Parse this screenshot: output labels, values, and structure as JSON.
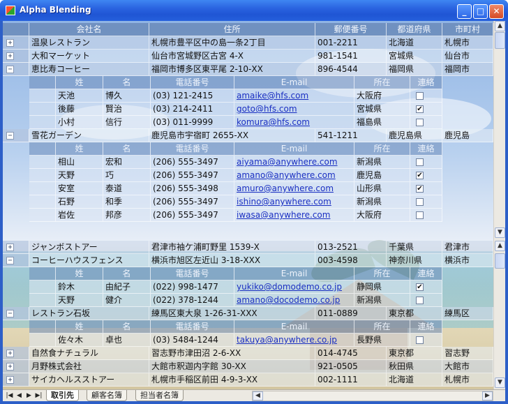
{
  "window": {
    "title": "Alpha Blending",
    "minimize_glyph": "_",
    "maximize_glyph": "□",
    "close_glyph": "✕"
  },
  "columns": [
    "会社名",
    "住所",
    "郵便番号",
    "都道府県",
    "市町村"
  ],
  "detail_columns": [
    "姓",
    "名",
    "電話番号",
    "E-mail",
    "所在",
    "連絡"
  ],
  "groups_top": [
    {
      "company": "温泉レストラン",
      "address": "札幌市豊平区中の島一条2丁目",
      "postal": "001-2211",
      "prefecture": "北海道",
      "city": "札幌市",
      "expander": "+",
      "contacts": []
    },
    {
      "company": "大和マーケット",
      "address": "仙台市宮城野区古宮 4-X",
      "postal": "981-1541",
      "prefecture": "宮城県",
      "city": "仙台市",
      "expander": "+",
      "contacts": []
    },
    {
      "company": "恵比寿コーヒー",
      "address": "福岡市博多区東平尾 2-10-XX",
      "postal": "896-4544",
      "prefecture": "福岡県",
      "city": "福岡市",
      "expander": "−",
      "contacts": [
        {
          "last": "天池",
          "first": "博久",
          "phone": "(03) 121-2415",
          "email": "amaike@hfs.com",
          "location": "大阪府",
          "contact": false
        },
        {
          "last": "後藤",
          "first": "賢治",
          "phone": "(03) 214-2411",
          "email": "goto@hfs.com",
          "location": "宮城県",
          "contact": true
        },
        {
          "last": "小村",
          "first": "信行",
          "phone": "(03) 011-9999",
          "email": "komura@hfs.com",
          "location": "福島県",
          "contact": false
        }
      ]
    },
    {
      "company": "雪花ガーデン",
      "address": "鹿児島市宇宿町 2655-XX",
      "postal": "541-1211",
      "prefecture": "鹿児島県",
      "city": "鹿児島",
      "expander": "−",
      "contacts": [
        {
          "last": "相山",
          "first": "宏和",
          "phone": "(206) 555-3497",
          "email": "aiyama@anywhere.com",
          "location": "新潟県",
          "contact": false
        },
        {
          "last": "天野",
          "first": "巧",
          "phone": "(206) 555-3497",
          "email": "amano@anywhere.com",
          "location": "鹿児島",
          "contact": true
        },
        {
          "last": "安室",
          "first": "泰道",
          "phone": "(206) 555-3498",
          "email": "amuro@anywhere.com",
          "location": "山形県",
          "contact": true
        },
        {
          "last": "石野",
          "first": "和季",
          "phone": "(206) 555-3497",
          "email": "ishino@anywhere.com",
          "location": "新潟県",
          "contact": false
        },
        {
          "last": "岩佐",
          "first": "邦彦",
          "phone": "(206) 555-3497",
          "email": "iwasa@anywhere.com",
          "location": "大阪府",
          "contact": false
        }
      ]
    }
  ],
  "groups_bottom": [
    {
      "company": "ジャンボストアー",
      "address": "君津市袖ケ浦町野里 1539-X",
      "postal": "013-2521",
      "prefecture": "千葉県",
      "city": "君津市",
      "expander": "+",
      "contacts": []
    },
    {
      "company": "コーヒーハウスフェンス",
      "address": "横浜市旭区左近山 3-18-XXX",
      "postal": "003-4598",
      "prefecture": "神奈川県",
      "city": "横浜市",
      "expander": "−",
      "contacts": [
        {
          "last": "鈴木",
          "first": "由紀子",
          "phone": "(022) 998-1477",
          "email": "yukiko@domodemo.co.jp",
          "location": "静岡県",
          "contact": true
        },
        {
          "last": "天野",
          "first": "健介",
          "phone": "(022) 378-1244",
          "email": "amano@docodemo.co.jp",
          "location": "新潟県",
          "contact": false
        }
      ]
    },
    {
      "company": "レストラン石坂",
      "address": "練馬区東大泉 1-26-31-XXX",
      "postal": "011-0889",
      "prefecture": "東京都",
      "city": "練馬区",
      "expander": "−",
      "contacts": [
        {
          "last": "佐々木",
          "first": "卓也",
          "phone": "(03) 5484-1244",
          "email": "takuya@anywhere.co.jp",
          "location": "長野県",
          "contact": false
        }
      ]
    },
    {
      "company": "自然食ナチュラル",
      "address": "習志野市津田沼 2-6-XX",
      "postal": "014-4745",
      "prefecture": "東京都",
      "city": "習志野",
      "expander": "+",
      "contacts": []
    },
    {
      "company": "月野株式会社",
      "address": "大館市釈迦内字館 30-XX",
      "postal": "921-0505",
      "prefecture": "秋田県",
      "city": "大館市",
      "expander": "+",
      "contacts": []
    },
    {
      "company": "サイカヘルスストアー",
      "address": "札幌市手稲区前田 4-9-3-XX",
      "postal": "002-1111",
      "prefecture": "北海道",
      "city": "札幌市",
      "expander": "+",
      "contacts": []
    }
  ],
  "sheet_tabs": [
    "取引先",
    "顧客名簿",
    "担当者名簿"
  ],
  "nav": {
    "first": "|◀",
    "prev": "◀",
    "next": "▶",
    "last": "▶|"
  },
  "scroll": {
    "up": "▲",
    "down": "▼",
    "left": "◀",
    "right": "▶"
  },
  "icons": {
    "app": "app-icon",
    "check": "check-icon",
    "expand": "expand-icon",
    "collapse": "collapse-icon"
  }
}
